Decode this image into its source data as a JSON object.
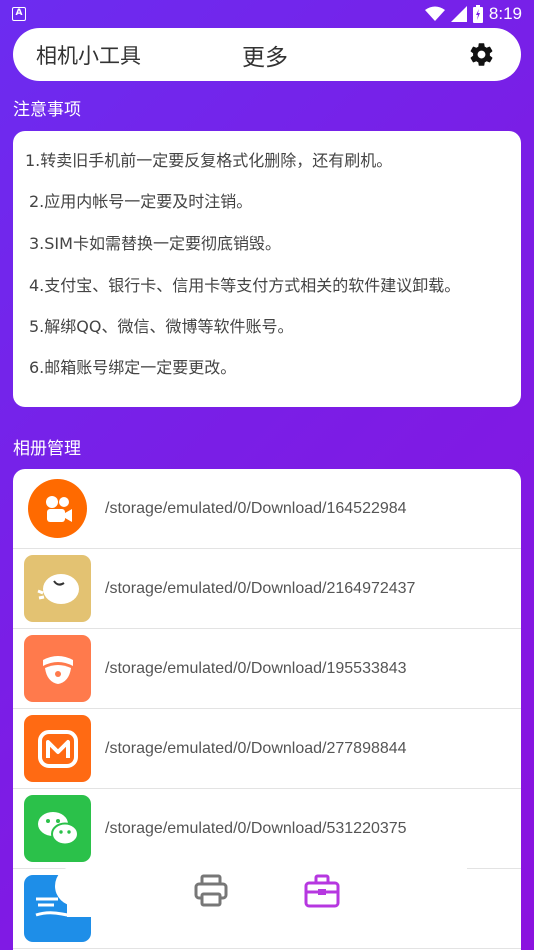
{
  "status_bar": {
    "time": "8:19",
    "icons": [
      "wifi-icon",
      "signal-icon",
      "battery-icon"
    ]
  },
  "top_bar": {
    "app_title": "相机小工具",
    "center_title": "更多",
    "settings_icon": "gear-icon"
  },
  "notice": {
    "heading": "注意事项",
    "lines": [
      "1.转卖旧手机前一定要反复格式化删除，还有刷机。",
      "2.应用内帐号一定要及时注销。",
      "3.SIM卡如需替换一定要彻底销毁。",
      "4.支付宝、银行卡、信用卡等支付方式相关的软件建议卸载。",
      "5.解绑QQ、微信、微博等软件账号。",
      "6.邮箱账号绑定一定要更改。"
    ]
  },
  "album": {
    "heading": "相册管理",
    "items": [
      {
        "icon": "kuaishou-icon",
        "color": "#ff6a00",
        "path": "/storage/emulated/0/Download/164522984"
      },
      {
        "icon": "chick-app-icon",
        "color": "#e3c272",
        "path": "/storage/emulated/0/Download/2164972437"
      },
      {
        "icon": "hand-app-icon",
        "color": "#ff7a4c",
        "path": "/storage/emulated/0/Download/195533843"
      },
      {
        "icon": "mango-tv-icon",
        "color": "#ff6a13",
        "path": "/storage/emulated/0/Download/277898844"
      },
      {
        "icon": "wechat-icon",
        "color": "#2bc14a",
        "path": "/storage/emulated/0/Download/531220375"
      },
      {
        "icon": "flyme-icon",
        "color": "#1e8ee8",
        "path": ""
      }
    ]
  },
  "bottom_nav": {
    "items": [
      {
        "icon": "printer-icon",
        "color": "#777777",
        "active": false
      },
      {
        "icon": "toolbox-icon",
        "color": "#b637e0",
        "active": true
      }
    ]
  }
}
